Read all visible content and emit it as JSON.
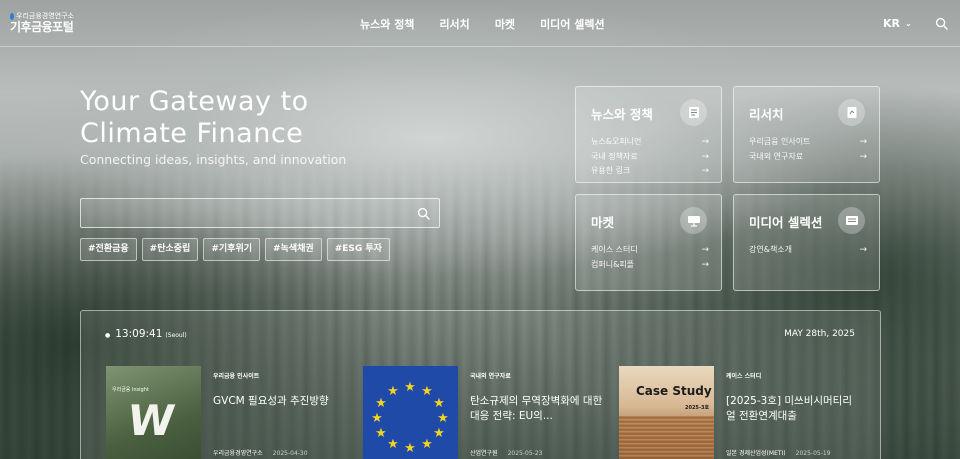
{
  "header": {
    "logo_top": "우리금융경영연구소",
    "logo_main": "기후금융포털",
    "nav": [
      "뉴스와 정책",
      "리서치",
      "마켓",
      "미디어 셀렉션"
    ],
    "lang": "KR",
    "icons": {
      "lang_chevron": "chevron-down-icon",
      "search": "search-icon"
    }
  },
  "hero": {
    "title_line1": "Your Gateway to",
    "title_line2": "Climate Finance",
    "subtitle": "Connecting ideas, insights, and innovation",
    "search": {
      "value": "",
      "placeholder": ""
    },
    "tags": [
      "#전환금융",
      "#탄소중립",
      "#기후위기",
      "#녹색채권",
      "#ESG 투자"
    ]
  },
  "cards": [
    {
      "title": "뉴스와 정책",
      "icon": "document-icon",
      "links": [
        "뉴스&오피니언",
        "국내 정책자료",
        "유용한 링크"
      ]
    },
    {
      "title": "리서치",
      "icon": "report-icon",
      "links": [
        "우리금융 인사이트",
        "국내외 연구자료"
      ]
    },
    {
      "title": "마켓",
      "icon": "presentation-icon",
      "links": [
        "케이스 스터디",
        "컴퍼니&피플"
      ]
    },
    {
      "title": "미디어 셀렉션",
      "icon": "media-icon",
      "links": [
        "강연&책소개"
      ]
    }
  ],
  "panel": {
    "time": "13:09:41",
    "timezone": "(Seoul)",
    "date": "MAY 28th, 2025",
    "items": [
      {
        "category": "우리금융 인사이트",
        "title": "GVCM 필요성과 추진방향",
        "source": "우리금융경영연구소",
        "date": "2025-04-30",
        "thumb_label": "우리금융 insight",
        "thumb_mark": "W"
      },
      {
        "category": "국내외 연구자료",
        "title": "탄소규제의 무역장벽화에 대한 대응 전략: EU의...",
        "source": "산업연구원",
        "date": "2025-05-23"
      },
      {
        "category": "케이스 스터디",
        "title": "[2025-3호] 미쓰비시머티리얼 전환연계대출",
        "source": "일본 경제산업성(METI)",
        "date": "2025-05-19",
        "thumb_label": "Case Study",
        "thumb_sub": "2025-3호"
      }
    ]
  },
  "colors": {
    "accent_blue": "#2d7fd1",
    "eu_blue": "#1f4aa8",
    "eu_star": "#f5d321"
  }
}
